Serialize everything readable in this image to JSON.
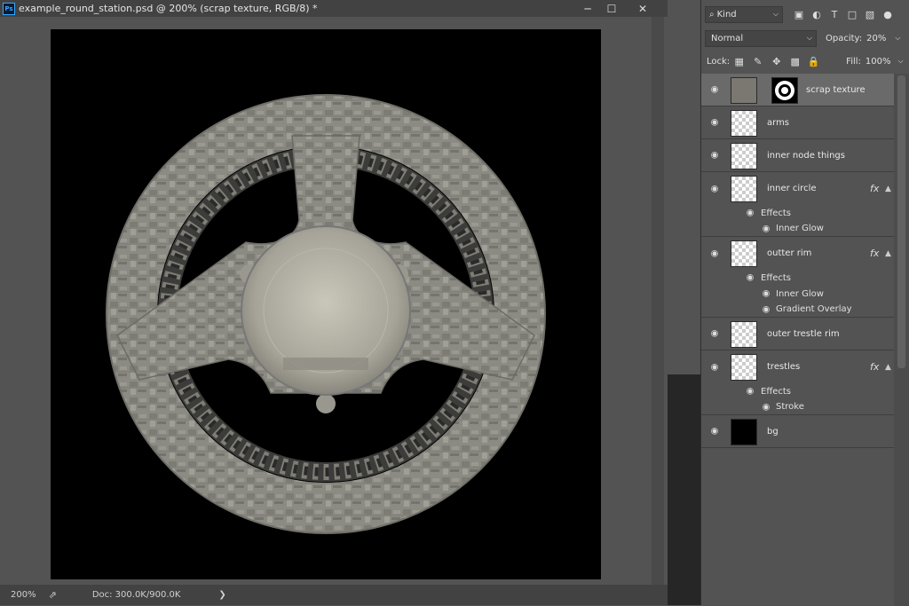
{
  "window": {
    "app_icon": "Ps",
    "title": "example_round_station.psd @ 200% (scrap texture, RGB/8) *",
    "buttons": [
      "minimize",
      "maximize",
      "close"
    ]
  },
  "status_bar": {
    "zoom": "200%",
    "doc_info": "Doc: 300.0K/900.0K",
    "arrow": "❯"
  },
  "layers_panel": {
    "filter_kind": "Kind",
    "blend_mode": "Normal",
    "opacity_label": "Opacity:",
    "opacity_value": "20%",
    "lock_label": "Lock:",
    "fill_label": "Fill:",
    "fill_value": "100%",
    "layers": [
      {
        "name": "scrap texture",
        "selected": true,
        "has_mask": true,
        "fx": false
      },
      {
        "name": "arms",
        "fx": false
      },
      {
        "name": "inner node things",
        "fx": false
      },
      {
        "name": "inner circle",
        "fx": true,
        "effects_label": "Effects",
        "effects": [
          "Inner Glow"
        ]
      },
      {
        "name": "outter rim",
        "fx": true,
        "effects_label": "Effects",
        "effects": [
          "Inner Glow",
          "Gradient Overlay"
        ]
      },
      {
        "name": "outer trestle rim",
        "fx": false
      },
      {
        "name": "trestles",
        "fx": true,
        "effects_label": "Effects",
        "effects": [
          "Stroke"
        ]
      },
      {
        "name": "bg",
        "fx": false
      }
    ],
    "fx_symbol": "fx"
  },
  "colors": {
    "ui_bg": "#535353",
    "panel_selected": "#6a6a6a",
    "titlebar": "#424242",
    "canvas_bg": "#000000",
    "station_metal": "#8f8d85"
  }
}
